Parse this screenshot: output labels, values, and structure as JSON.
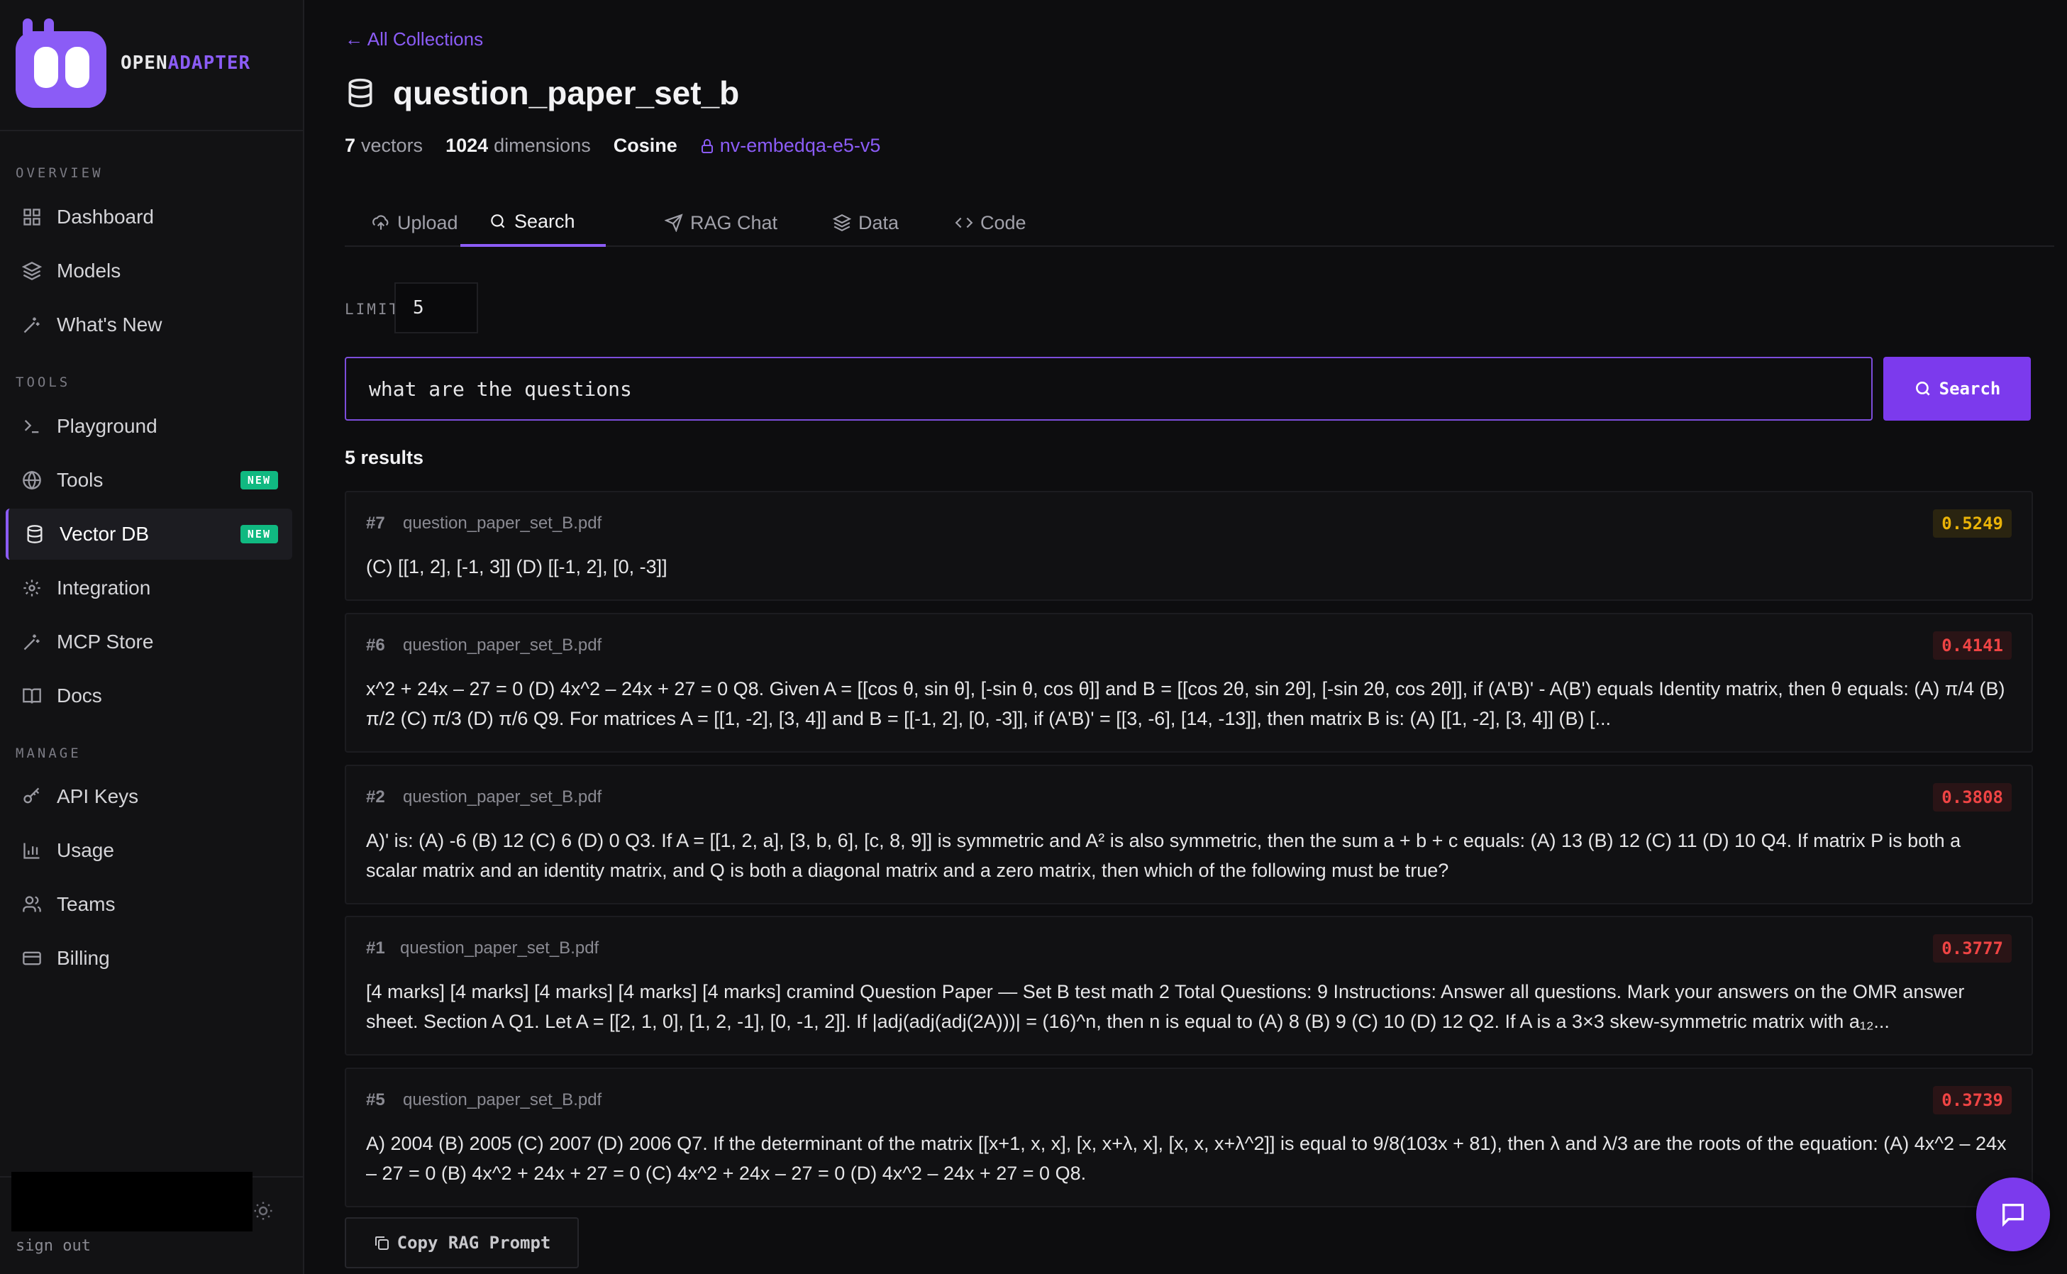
{
  "brand": {
    "name_prefix": "OPEN",
    "name_accent": "ADAPTER"
  },
  "sidebar": {
    "sections": [
      {
        "label": "OVERVIEW"
      },
      {
        "label": "TOOLS"
      },
      {
        "label": "MANAGE"
      }
    ],
    "items": [
      {
        "label": "Dashboard",
        "icon": "grid-icon"
      },
      {
        "label": "Models",
        "icon": "layers-icon"
      },
      {
        "label": "What's New",
        "icon": "sparkle-icon"
      },
      {
        "label": "Playground",
        "icon": "terminal-icon"
      },
      {
        "label": "Tools",
        "icon": "globe-icon",
        "badge": "NEW"
      },
      {
        "label": "Vector DB",
        "icon": "database-icon",
        "badge": "NEW",
        "active": true
      },
      {
        "label": "Integration",
        "icon": "gear-icon"
      },
      {
        "label": "MCP Store",
        "icon": "sparkle-icon"
      },
      {
        "label": "Docs",
        "icon": "book-icon"
      },
      {
        "label": "API Keys",
        "icon": "key-icon"
      },
      {
        "label": "Usage",
        "icon": "bar-chart-icon"
      },
      {
        "label": "Teams",
        "icon": "users-icon"
      },
      {
        "label": "Billing",
        "icon": "credit-card-icon"
      }
    ],
    "sign_out": "sign out"
  },
  "header": {
    "back_link": "← All Collections",
    "collection_title": "question_paper_set_b",
    "meta": {
      "vectors_count": "7",
      "vectors_label": "vectors",
      "dimensions_count": "1024",
      "dimensions_label": "dimensions",
      "metric": "Cosine",
      "model": "nv-embedqa-e5-v5"
    }
  },
  "tabs": [
    {
      "label": "Upload",
      "icon": "upload-cloud-icon"
    },
    {
      "label": "Search",
      "icon": "search-icon",
      "active": true
    },
    {
      "label": "RAG Chat",
      "icon": "send-icon"
    },
    {
      "label": "Data",
      "icon": "layers-icon"
    },
    {
      "label": "Code",
      "icon": "code-icon"
    }
  ],
  "search": {
    "limit_label": "LIMIT",
    "limit_value": "5",
    "query": "what are the questions",
    "button_label": "Search",
    "results_count": "5 results"
  },
  "results": [
    {
      "rank": "#7",
      "source": "question_paper_set_B.pdf",
      "score": "0.5249",
      "text": "(C) [[1, 2], [-1, 3]] (D) [[-1, 2], [0, -3]]"
    },
    {
      "rank": "#6",
      "source": "question_paper_set_B.pdf",
      "score": "0.4141",
      "text": "x^2 + 24x – 27 = 0 (D) 4x^2 – 24x + 27 = 0 Q8. Given A = [[cos θ, sin θ], [-sin θ, cos θ]] and B = [[cos 2θ, sin 2θ], [-sin 2θ, cos 2θ]], if (A'B)' - A(B') equals Identity matrix, then θ equals: (A) π/4 (B) π/2 (C) π/3 (D) π/6 Q9. For matrices A = [[1, -2], [3, 4]] and B = [[-1, 2], [0, -3]], if (A'B)' = [[3, -6], [14, -13]], then matrix B is: (A) [[1, -2], [3, 4]] (B) [..."
    },
    {
      "rank": "#2",
      "source": "question_paper_set_B.pdf",
      "score": "0.3808",
      "text": "A)' is: (A) -6 (B) 12 (C) 6 (D) 0 Q3. If A = [[1, 2, a], [3, b, 6], [c, 8, 9]] is symmetric and A² is also symmetric, then the sum a + b + c equals: (A) 13 (B) 12 (C) 11 (D) 10 Q4. If matrix P is both a scalar matrix and an identity matrix, and Q is both a diagonal matrix and a zero matrix, then which of the following must be true?"
    },
    {
      "rank": "#1",
      "source": "question_paper_set_B.pdf",
      "score": "0.3777",
      "text": "[4 marks] [4 marks] [4 marks] [4 marks] [4 marks] cramind Question Paper — Set B test math 2 Total Questions: 9 Instructions: Answer all questions. Mark your answers on the OMR answer sheet. Section A Q1. Let A = [[2, 1, 0], [1, 2, -1], [0, -1, 2]]. If |adj(adj(adj(2A)))| = (16)^n, then n is equal to (A) 8 (B) 9 (C) 10 (D) 12 Q2. If A is a 3×3 skew-symmetric matrix with a₁₂..."
    },
    {
      "rank": "#5",
      "source": "question_paper_set_B.pdf",
      "score": "0.3739",
      "text": "A) 2004 (B) 2005 (C) 2007 (D) 2006 Q7. If the determinant of the matrix [[x+1, x, x], [x, x+λ, x], [x, x, x+λ^2]] is equal to 9/8(103x + 81), then λ and λ/3 are the roots of the equation: (A) 4x^2 – 24x – 27 = 0 (B) 4x^2 + 24x + 27 = 0 (C) 4x^2 + 24x – 27 = 0 (D) 4x^2 – 24x + 27 = 0 Q8."
    }
  ],
  "copy_rag_prompt_label": "Copy RAG Prompt",
  "colors": {
    "accent": "#7c3aed",
    "score_high": "#eab308",
    "score_low": "#ef4444",
    "badge_new": "#10b981"
  }
}
